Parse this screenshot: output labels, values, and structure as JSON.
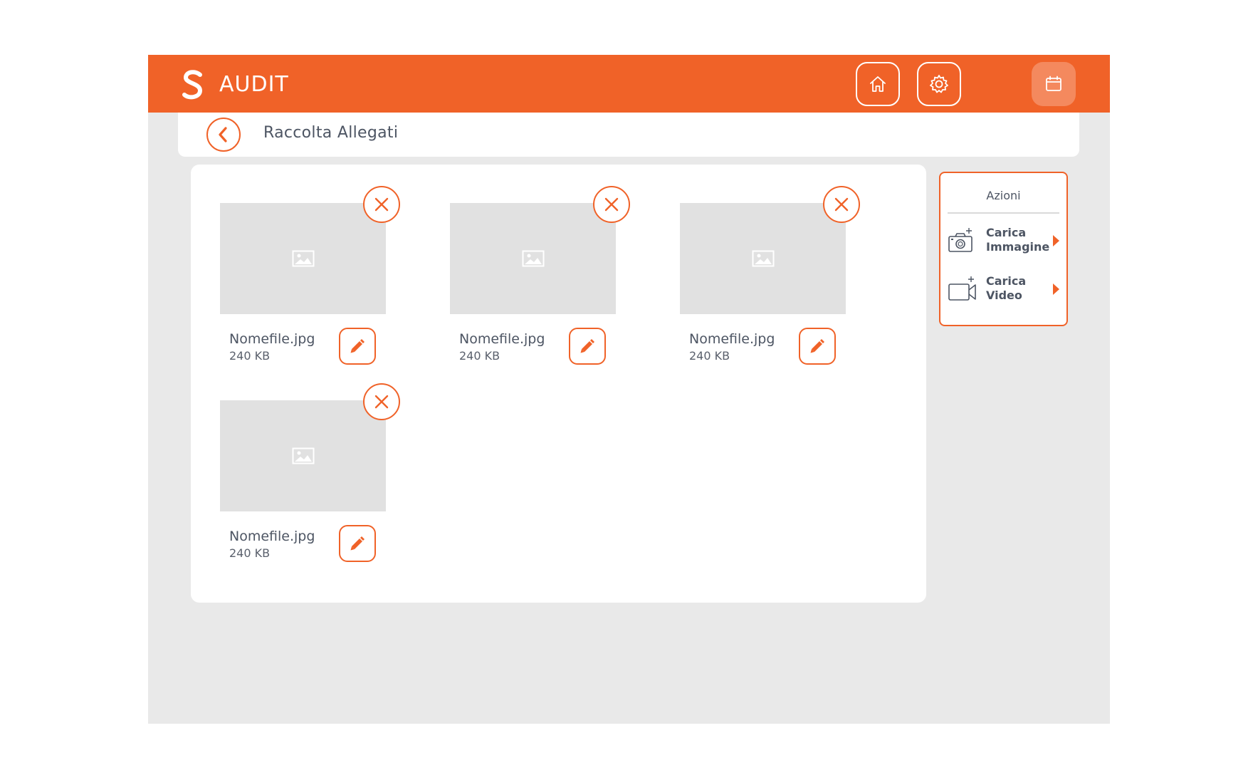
{
  "header": {
    "title": "AUDIT",
    "logo_icon": "s-logo-icon",
    "buttons": [
      {
        "name": "home-button",
        "icon": "home-icon"
      },
      {
        "name": "settings-button",
        "icon": "gear-icon"
      },
      {
        "name": "calendar-button",
        "icon": "calendar-icon"
      }
    ],
    "accent_color": "#f06228"
  },
  "subheader": {
    "title": "Raccolta Allegati"
  },
  "attachments": [
    {
      "filename": "Nomefile.jpg",
      "size": "240 KB"
    },
    {
      "filename": "Nomefile.jpg",
      "size": "240 KB"
    },
    {
      "filename": "Nomefile.jpg",
      "size": "240 KB"
    },
    {
      "filename": "Nomefile.jpg",
      "size": "240 KB"
    }
  ],
  "actions": {
    "title": "Azioni",
    "items": [
      {
        "line1": "Carica",
        "line2": "Immagine",
        "icon": "add-camera-icon"
      },
      {
        "line1": "Carica",
        "line2": "Video",
        "icon": "add-video-icon"
      }
    ]
  }
}
